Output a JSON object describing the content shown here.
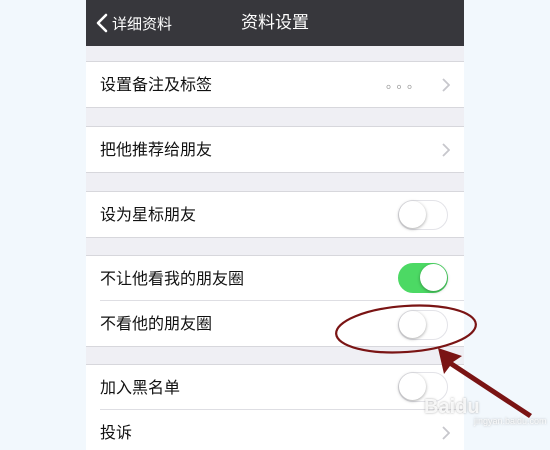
{
  "navbar": {
    "back_label": "详细资料",
    "title": "资料设置",
    "background": "#37373c"
  },
  "rows": {
    "remark_tags": {
      "label": "设置备注及标签",
      "value": "。。。"
    },
    "recommend": {
      "label": "把他推荐给朋友"
    },
    "star_friend": {
      "label": "设为星标朋友",
      "on": false
    },
    "hide_my_moments": {
      "label": "不让他看我的朋友圈",
      "on": true
    },
    "hide_his_moments": {
      "label": "不看他的朋友圈",
      "on": false
    },
    "blacklist": {
      "label": "加入黑名单",
      "on": false
    },
    "report": {
      "label": "投诉"
    }
  },
  "annotation": {
    "color": "#7a1414",
    "shape": "ellipse-with-arrow"
  },
  "watermark": {
    "brand": "Baidu",
    "sub": "jingyan.baidu.com"
  },
  "colors": {
    "switch_on": "#4cd964",
    "group_background": "#efeff4"
  }
}
